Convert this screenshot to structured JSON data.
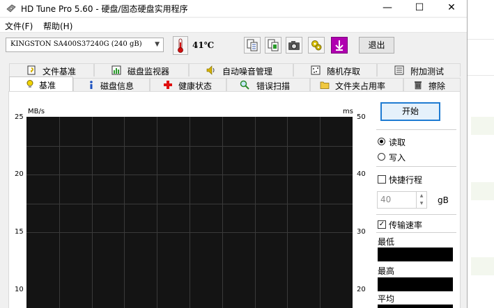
{
  "window": {
    "title": "HD Tune Pro 5.60 - 硬盘/固态硬盘实用程序",
    "controls": {
      "minimize": "—",
      "maximize": "☐",
      "close": "✕"
    }
  },
  "menu": {
    "file": "文件(F)",
    "help": "帮助(H)"
  },
  "toolbar": {
    "drive": "KINGSTON SA400S37240G (240 gB)",
    "temperature": "41℃",
    "exit": "退出",
    "icons": [
      "copy-text-icon",
      "copy-screen-icon",
      "camera-icon",
      "settings-icon",
      "download-icon"
    ]
  },
  "tabs_row1": [
    "文件基准",
    "磁盘监视器",
    "自动噪音管理",
    "随机存取",
    "附加测试"
  ],
  "tabs_row2": [
    "基准",
    "磁盘信息",
    "健康状态",
    "错误扫描",
    "文件夹占用率",
    "擦除"
  ],
  "chart_data": {
    "type": "line",
    "left_axis_unit": "MB/s",
    "right_axis_unit": "ms",
    "left_ticks": [
      "25",
      "20",
      "15",
      "10"
    ],
    "right_ticks": [
      "50",
      "40",
      "30",
      "20"
    ],
    "series": []
  },
  "controls": {
    "start": "开始",
    "read": "读取",
    "write": "写入",
    "read_selected": true,
    "short_stroke": "快捷行程",
    "short_stroke_checked": false,
    "stroke_value": "40",
    "stroke_unit": "gB",
    "transfer_rate": "传输速率",
    "transfer_rate_checked": true,
    "min_label": "最低",
    "max_label": "最高",
    "avg_label": "平均"
  },
  "colors": {
    "chart_bg": "#141414",
    "accent": "#1e7bd2"
  }
}
